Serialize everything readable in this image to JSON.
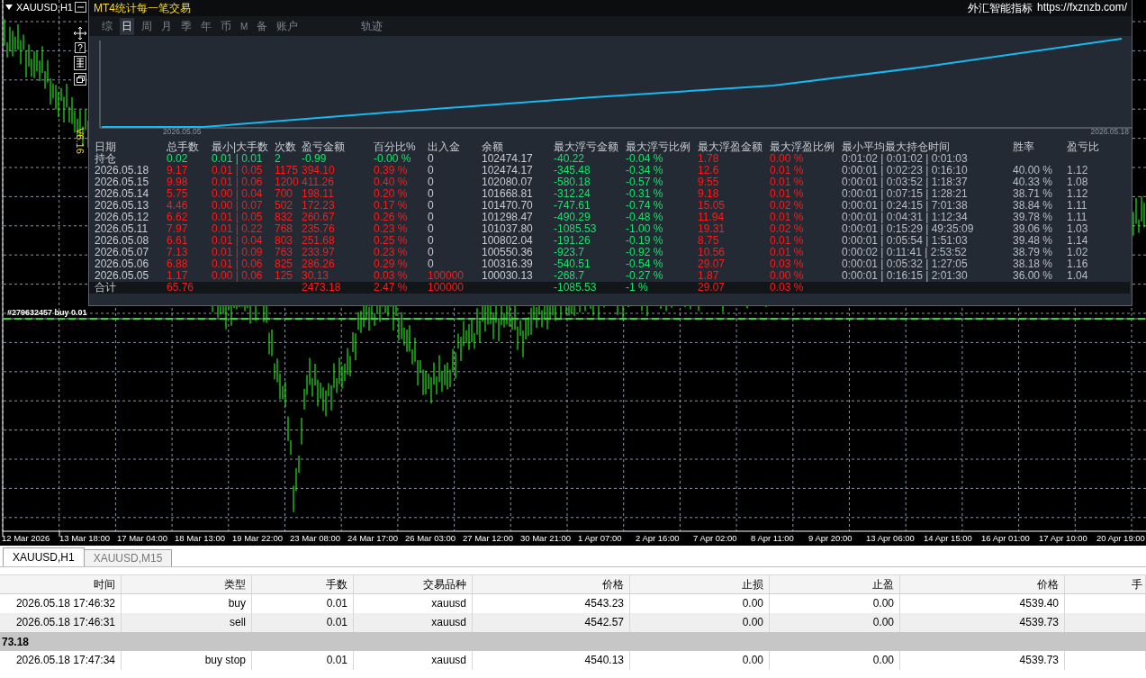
{
  "chart": {
    "symbol_label": "XAUUSD,H1",
    "order_label": "#279632457 buy 0.01",
    "time_axis": [
      "12 Mar 2026",
      "13 Mar 18:00",
      "17 Mar 04:00",
      "18 Mar 13:00",
      "19 Mar 22:00",
      "23 Mar 08:00",
      "24 Mar 17:00",
      "26 Mar 03:00",
      "27 Mar 12:00",
      "30 Mar 21:00",
      "1 Apr 07:00",
      "2 Apr 16:00",
      "7 Apr 02:00",
      "8 Apr 11:00",
      "9 Apr 20:00",
      "13 Apr 06:00",
      "14 Apr 15:00",
      "16 Apr 01:00",
      "17 Apr 10:00",
      "20 Apr 19:00"
    ]
  },
  "panel": {
    "title": "MT4统计每一笔交易",
    "version": "V6.16",
    "help_button": "?",
    "brand": "外汇智能指标",
    "url": "https://fxznzb.com/",
    "tabs": [
      {
        "label": "综",
        "selected": false
      },
      {
        "label": "日",
        "selected": true
      },
      {
        "label": "周",
        "selected": false
      },
      {
        "label": "月",
        "selected": false
      },
      {
        "label": "季",
        "selected": false
      },
      {
        "label": "年",
        "selected": false
      },
      {
        "label": "币",
        "selected": false
      },
      {
        "label": "M",
        "selected": false
      },
      {
        "label": "备",
        "selected": false
      },
      {
        "label": "账户",
        "selected": false
      },
      {
        "label": "轨迹",
        "selected": false
      }
    ],
    "curve": {
      "start_label": "2026.05.05",
      "end_label": "2026.05.18"
    },
    "stats": {
      "columns": [
        "日期",
        "总手数",
        "最小|大手数",
        "次数",
        "盈亏金额",
        "百分比%",
        "出入金",
        "余额",
        "最大浮亏金额",
        "最大浮亏比例",
        "最大浮盈金额",
        "最大浮盈比例",
        "最小平均最大持仓时间",
        "胜率",
        "盈亏比"
      ],
      "rows": [
        {
          "kind": "open",
          "cells": [
            "持仓",
            "0.02",
            "0.01 | 0.01",
            "2",
            "-0.99",
            "-0.00 %",
            "0",
            "102474.17",
            "-40.22",
            "-0.04 %",
            "1.78",
            "0.00 %",
            "0:01:02 | 0:01:02 | 0:01:03"
          ]
        },
        {
          "kind": "day",
          "cells": [
            "2026.05.18",
            "9.17",
            "0.01 | 0.05",
            "1175",
            "394.10",
            "0.39 %",
            "0",
            "102474.17",
            "-345.48",
            "-0.34 %",
            "12.6",
            "0.01 %",
            "0:00:01 | 0:02:23 | 0:16:10",
            "40.00 %",
            "1.12"
          ]
        },
        {
          "kind": "day",
          "cells": [
            "2026.05.15",
            "9.98",
            "0.01 | 0.06",
            "1200",
            "411.26",
            "0.40 %",
            "0",
            "102080.07",
            "-580.18",
            "-0.57 %",
            "9.55",
            "0.01 %",
            "0:00:01 | 0:03:52 | 1:18:37",
            "40.33 %",
            "1.08"
          ]
        },
        {
          "kind": "day",
          "cells": [
            "2026.05.14",
            "5.75",
            "0.00 | 0.04",
            "700",
            "198.11",
            "0.20 %",
            "0",
            "101668.81",
            "-312.24",
            "-0.31 %",
            "9.18",
            "0.01 %",
            "0:00:01 | 0:07:15 | 1:28:21",
            "38.71 %",
            "1.12"
          ]
        },
        {
          "kind": "day",
          "cells": [
            "2026.05.13",
            "4.46",
            "0.00 | 0.07",
            "502",
            "172.23",
            "0.17 %",
            "0",
            "101470.70",
            "-747.61",
            "-0.74 %",
            "15.05",
            "0.02 %",
            "0:00:01 | 0:24:15 | 7:01:38",
            "38.84 %",
            "1.11"
          ]
        },
        {
          "kind": "day",
          "cells": [
            "2026.05.12",
            "6.62",
            "0.01 | 0.05",
            "832",
            "260.67",
            "0.26 %",
            "0",
            "101298.47",
            "-490.29",
            "-0.48 %",
            "11.94",
            "0.01 %",
            "0:00:01 | 0:04:31 | 1:12:34",
            "39.78 %",
            "1.11"
          ]
        },
        {
          "kind": "day",
          "cells": [
            "2026.05.11",
            "7.97",
            "0.01 | 0.22",
            "768",
            "235.76",
            "0.23 %",
            "0",
            "101037.80",
            "-1085.53",
            "-1.00 %",
            "19.31",
            "0.02 %",
            "0:00:01 | 0:15:29 | 49:35:09",
            "39.06 %",
            "1.03"
          ]
        },
        {
          "kind": "day",
          "cells": [
            "2026.05.08",
            "6.61",
            "0.01 | 0.04",
            "803",
            "251.68",
            "0.25 %",
            "0",
            "100802.04",
            "-191.26",
            "-0.19 %",
            "8.75",
            "0.01 %",
            "0:00:01 | 0:05:54 | 1:51:03",
            "39.48 %",
            "1.14"
          ]
        },
        {
          "kind": "day",
          "cells": [
            "2026.05.07",
            "7.13",
            "0.01 | 0.09",
            "763",
            "233.97",
            "0.23 %",
            "0",
            "100550.36",
            "-923.7",
            "-0.92 %",
            "10.56",
            "0.01 %",
            "0:00:02 | 0:11:41 | 2:53:52",
            "38.79 %",
            "1.02"
          ]
        },
        {
          "kind": "day",
          "cells": [
            "2026.05.06",
            "6.88",
            "0.01 | 0.06",
            "825",
            "286.26",
            "0.29 %",
            "0",
            "100316.39",
            "-540.51",
            "-0.54 %",
            "29.07",
            "0.03 %",
            "0:00:01 | 0:05:32 | 1:27:05",
            "38.18 %",
            "1.16"
          ]
        },
        {
          "kind": "day",
          "cells": [
            "2026.05.05",
            "1.17",
            "0.00 | 0.06",
            "125",
            "30.13",
            "0.03 %",
            "100000",
            "100030.13",
            "-268.7",
            "-0.27 %",
            "1.87",
            "0.00 %",
            "0:00:01 | 0:16:15 | 2:01:30",
            "36.00 %",
            "1.04"
          ]
        },
        {
          "kind": "total",
          "cells": [
            "合计",
            "65.76",
            null,
            null,
            "2473.18",
            "2.47 %",
            "100000",
            null,
            "-1085.53",
            "-1 %",
            "29.07",
            "0.03 %"
          ]
        }
      ]
    }
  },
  "chart_tabs": [
    {
      "label": "XAUUSD,H1",
      "selected": true
    },
    {
      "label": "XAUUSD,M15",
      "selected": false
    }
  ],
  "trades": {
    "columns": [
      "时间",
      "类型",
      "手数",
      "交易品种",
      "价格",
      "止损",
      "止盈",
      "价格",
      "手"
    ],
    "rows": [
      {
        "kind": "order",
        "cells": [
          "2026.05.18 17:46:32",
          "buy",
          "0.01",
          "xauusd",
          "4543.23",
          "0.00",
          "0.00",
          "4539.40"
        ]
      },
      {
        "kind": "order",
        "cells": [
          "2026.05.18 17:46:31",
          "sell",
          "0.01",
          "xauusd",
          "4542.57",
          "0.00",
          "0.00",
          "4539.73"
        ]
      },
      {
        "kind": "summary",
        "cells": [
          "73.18"
        ]
      },
      {
        "kind": "order",
        "cells": [
          "2026.05.18 17:47:34",
          "buy stop",
          "0.01",
          "xauusd",
          "4540.13",
          "0.00",
          "0.00",
          "4539.73"
        ]
      }
    ]
  }
}
